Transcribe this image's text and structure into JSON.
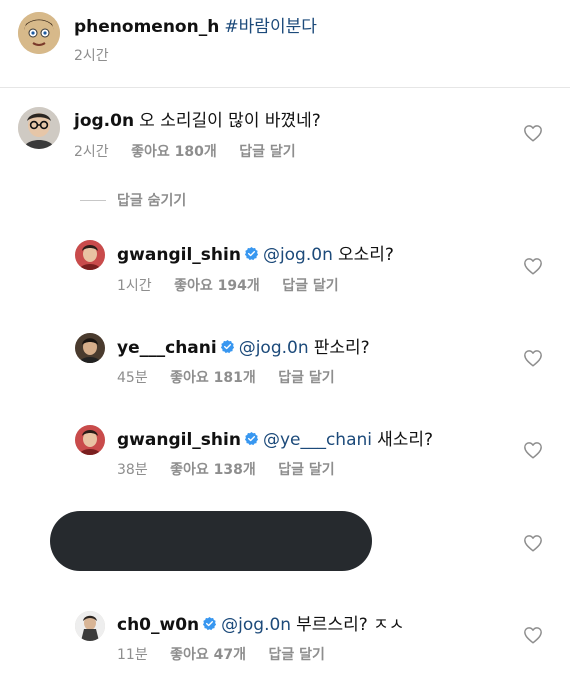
{
  "post": {
    "username": "phenomenon_h",
    "hashtag": "#바람이분다",
    "time": "2시간"
  },
  "main_comment": {
    "username": "jog.0n",
    "text": "오 소리길이 많이 바꼈네?",
    "time": "2시간",
    "likes": "좋아요 180개",
    "reply": "답글 달기"
  },
  "hide_replies": "답글 숨기기",
  "replies": [
    {
      "username": "gwangil_shin",
      "mention": "@jog.0n",
      "text": "오소리?",
      "time": "1시간",
      "likes": "좋아요 194개",
      "reply": "답글 달기"
    },
    {
      "username": "ye___chani",
      "mention": "@jog.0n",
      "text": "판소리?",
      "time": "45분",
      "likes": "좋아요 181개",
      "reply": "답글 달기"
    },
    {
      "username": "gwangil_shin",
      "mention": "@ye___chani",
      "text": "새소리?",
      "time": "38분",
      "likes": "좋아요 138개",
      "reply": "답글 달기"
    },
    {
      "username": "ch0_w0n",
      "mention": "@jog.0n",
      "text": "부르스리? ㅈㅅ",
      "time": "11분",
      "likes": "좋아요 47개",
      "reply": "답글 달기"
    }
  ],
  "colors": {
    "mention": "#1c4a7a",
    "verified": "#3897f0",
    "redacted": "#262a2e"
  },
  "icons": [
    "heart-icon",
    "verified-badge-icon"
  ]
}
